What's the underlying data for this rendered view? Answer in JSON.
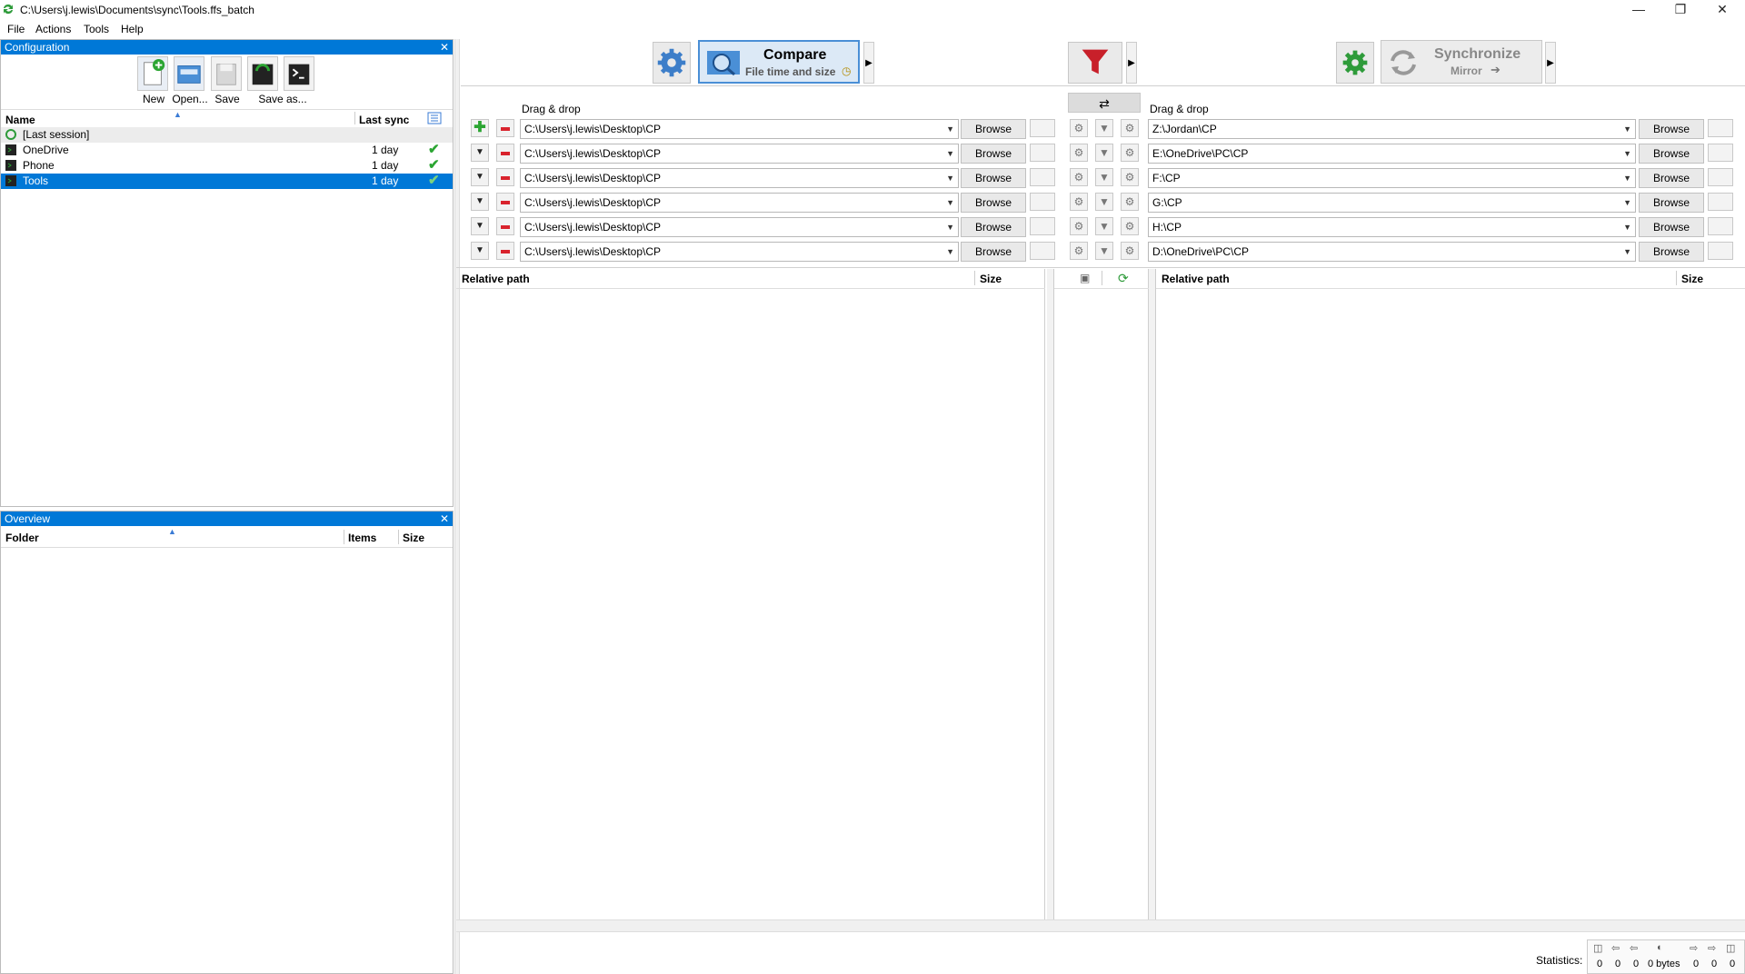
{
  "window": {
    "title": "C:\\Users\\j.lewis\\Documents\\sync\\Tools.ffs_batch"
  },
  "menu": [
    "File",
    "Actions",
    "Tools",
    "Help"
  ],
  "config_panel": {
    "title": "Configuration",
    "toolbar": [
      "New",
      "Open...",
      "Save",
      "Save as..."
    ],
    "col_name": "Name",
    "col_last_sync": "Last sync",
    "items": [
      {
        "name": "[Last session]",
        "last_sync": "",
        "ok": false
      },
      {
        "name": "OneDrive",
        "last_sync": "1 day",
        "ok": true
      },
      {
        "name": "Phone",
        "last_sync": "1 day",
        "ok": true
      },
      {
        "name": "Tools",
        "last_sync": "1 day",
        "ok": true,
        "selected": true
      }
    ]
  },
  "overview_panel": {
    "title": "Overview",
    "col_folder": "Folder",
    "col_items": "Items",
    "col_size": "Size"
  },
  "compare": {
    "label": "Compare",
    "sub": "File time and size"
  },
  "sync": {
    "label": "Synchronize",
    "sub": "Mirror"
  },
  "left": {
    "drag_label": "Drag & drop",
    "browse": "Browse",
    "paths": [
      "C:\\Users\\j.lewis\\Desktop\\CP",
      "C:\\Users\\j.lewis\\Desktop\\CP",
      "C:\\Users\\j.lewis\\Desktop\\CP",
      "C:\\Users\\j.lewis\\Desktop\\CP",
      "C:\\Users\\j.lewis\\Desktop\\CP",
      "C:\\Users\\j.lewis\\Desktop\\CP"
    ]
  },
  "right": {
    "drag_label": "Drag & drop",
    "browse": "Browse",
    "paths": [
      "Z:\\Jordan\\CP",
      "E:\\OneDrive\\PC\\CP",
      "F:\\CP",
      "G:\\CP",
      "H:\\CP",
      "D:\\OneDrive\\PC\\CP"
    ]
  },
  "grid": {
    "rel_path": "Relative path",
    "size": "Size"
  },
  "statistics": {
    "label": "Statistics:",
    "values": [
      "0",
      "0",
      "0",
      "0 bytes",
      "0",
      "0",
      "0"
    ]
  },
  "colors": {
    "accent": "#0078d7",
    "ok": "#2ba532",
    "filter": "#c8202a",
    "gear_green": "#2e9b3a"
  }
}
